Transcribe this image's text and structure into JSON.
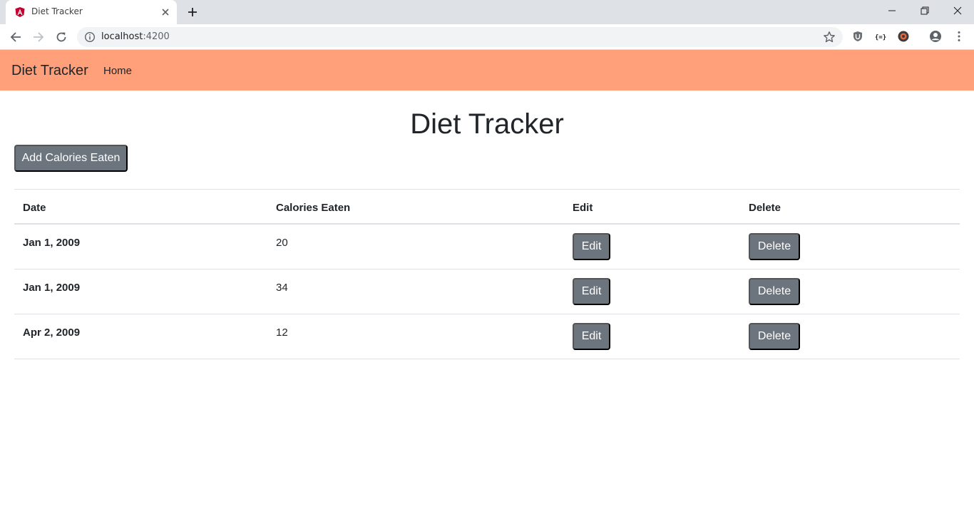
{
  "browser": {
    "tab_title": "Diet Tracker",
    "url_host": "localhost",
    "url_port": ":4200"
  },
  "navbar": {
    "brand": "Diet Tracker",
    "links": [
      "Home"
    ],
    "color": "#ffa07a"
  },
  "page": {
    "title": "Diet Tracker",
    "add_button": "Add Calories Eaten"
  },
  "table": {
    "headers": [
      "Date",
      "Calories Eaten",
      "Edit",
      "Delete"
    ],
    "rows": [
      {
        "date": "Jan 1, 2009",
        "calories": "20",
        "edit": "Edit",
        "delete": "Delete"
      },
      {
        "date": "Jan 1, 2009",
        "calories": "34",
        "edit": "Edit",
        "delete": "Delete"
      },
      {
        "date": "Apr 2, 2009",
        "calories": "12",
        "edit": "Edit",
        "delete": "Delete"
      }
    ]
  },
  "colors": {
    "button_gray": "#6c757d",
    "border": "#dee2e6"
  }
}
